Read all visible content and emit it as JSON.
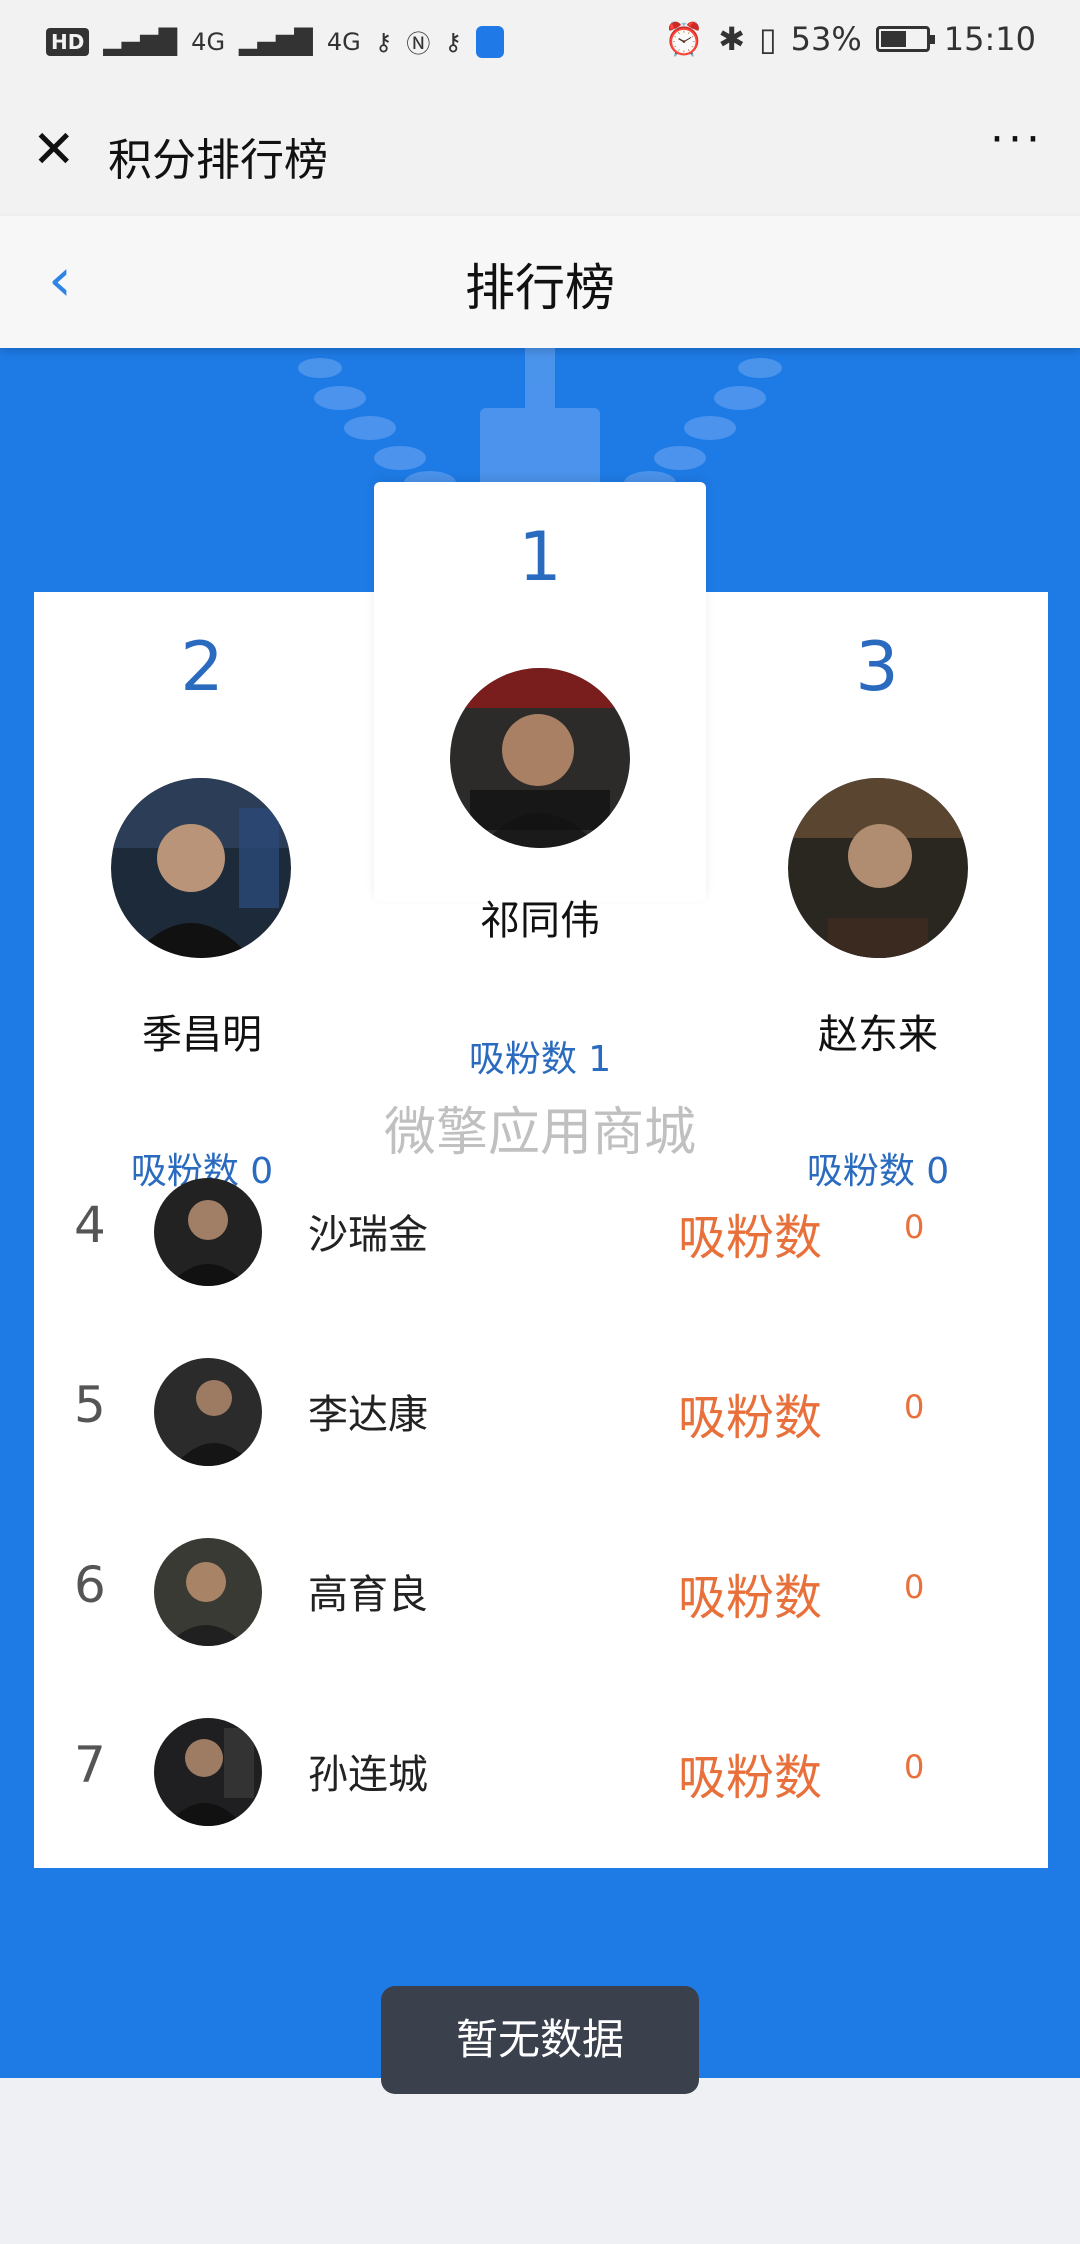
{
  "status_bar": {
    "left_badges": [
      "HD",
      "4G",
      "4G"
    ],
    "battery": "53%",
    "time": "15:10"
  },
  "wechat_nav": {
    "title": "积分排行榜",
    "more": "···"
  },
  "page": {
    "title": "排行榜"
  },
  "podium": [
    {
      "rank": "2",
      "name": "季昌明",
      "fans": "吸粉数 0"
    },
    {
      "rank": "1",
      "name": "祁同伟",
      "fans": "吸粉数 1"
    },
    {
      "rank": "3",
      "name": "赵东来",
      "fans": "吸粉数 0"
    }
  ],
  "watermark": "微擎应用商城",
  "list": [
    {
      "rank": "4",
      "name": "沙瑞金",
      "label": "吸粉数",
      "value": "0"
    },
    {
      "rank": "5",
      "name": "李达康",
      "label": "吸粉数",
      "value": "0"
    },
    {
      "rank": "6",
      "name": "高育良",
      "label": "吸粉数",
      "value": "0"
    },
    {
      "rank": "7",
      "name": "孙连城",
      "label": "吸粉数",
      "value": "0"
    }
  ],
  "toast": "暂无数据",
  "colors": {
    "primary_blue": "#1e7be6",
    "rank_blue": "#2a6bbf",
    "orange": "#e8703a"
  }
}
